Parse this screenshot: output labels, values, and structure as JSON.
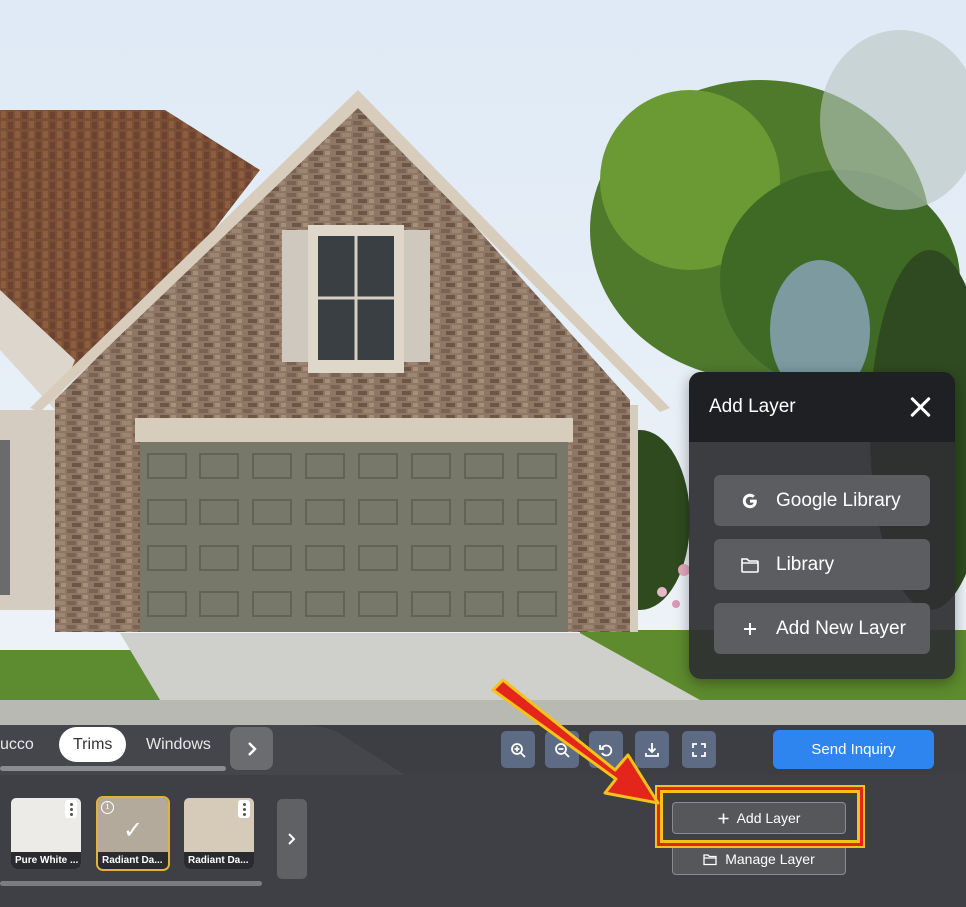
{
  "popup": {
    "title": "Add Layer",
    "options": [
      {
        "label": "Google Library",
        "icon": "google-icon"
      },
      {
        "label": "Library",
        "icon": "folder-icon"
      },
      {
        "label": "Add New Layer",
        "icon": "plus-icon"
      }
    ]
  },
  "tabs": {
    "items": [
      {
        "label": "ucco",
        "active": false
      },
      {
        "label": "Trims",
        "active": true
      },
      {
        "label": "Windows",
        "active": false
      }
    ]
  },
  "controls": [
    "zoom-in-icon",
    "zoom-out-icon",
    "undo-icon",
    "download-icon",
    "fullscreen-icon"
  ],
  "send_inquiry": "Send Inquiry",
  "swatches": [
    {
      "label": "Pure White ...",
      "color": "#ecebe8",
      "selected": false
    },
    {
      "label": "Radiant Da...",
      "color": "#b3aa9c",
      "selected": true
    },
    {
      "label": "Radiant Da...",
      "color": "#d6cbb8",
      "selected": false
    }
  ],
  "layer_buttons": {
    "add": "Add Layer",
    "manage": "Manage Layer"
  },
  "colors": {
    "accent_blue": "#2f85f0",
    "highlight_red": "#e8241a",
    "highlight_yellow": "#f4c21a"
  }
}
